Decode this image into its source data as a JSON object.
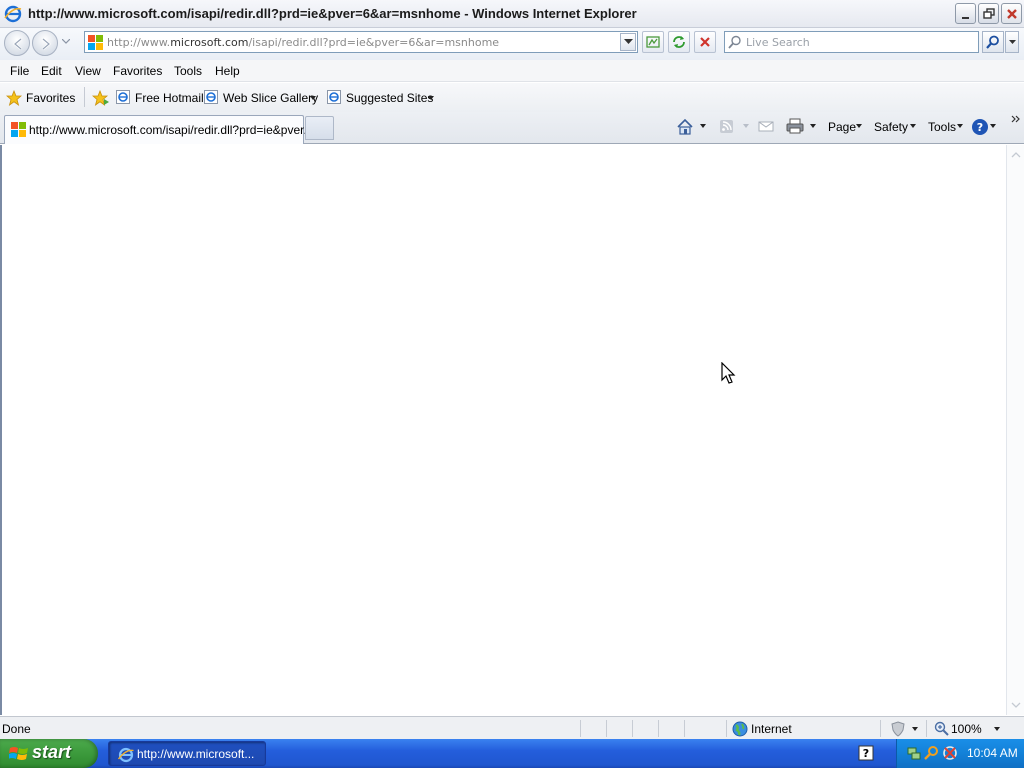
{
  "window": {
    "title": "http://www.microsoft.com/isapi/redir.dll?prd=ie&pver=6&ar=msnhome - Windows Internet Explorer"
  },
  "navbar": {
    "address_prefix": "http://www.",
    "address_domain": "microsoft.com",
    "address_suffix": "/isapi/redir.dll?prd=ie&pver=6&ar=msnhome",
    "search_placeholder": "Live Search"
  },
  "menu": {
    "items": [
      "File",
      "Edit",
      "View",
      "Favorites",
      "Tools",
      "Help"
    ]
  },
  "favorites_bar": {
    "favorites_label": "Favorites",
    "links": [
      "Free Hotmail",
      "Web Slice Gallery",
      "Suggested Sites"
    ]
  },
  "tabs": {
    "active_tab_title": "http://www.microsoft.com/isapi/redir.dll?prd=ie&pver..."
  },
  "command_bar": {
    "page_label": "Page",
    "safety_label": "Safety",
    "tools_label": "Tools"
  },
  "status": {
    "text": "Done",
    "zone": "Internet",
    "zoom": "100%"
  },
  "taskbar": {
    "start_label": "start",
    "task_label": "http://www.microsoft...",
    "clock": "10:04 AM"
  },
  "colors": {
    "taskbar_blue": "#245edc",
    "start_green": "#3c9a3c",
    "address_border": "#7f9db9"
  }
}
